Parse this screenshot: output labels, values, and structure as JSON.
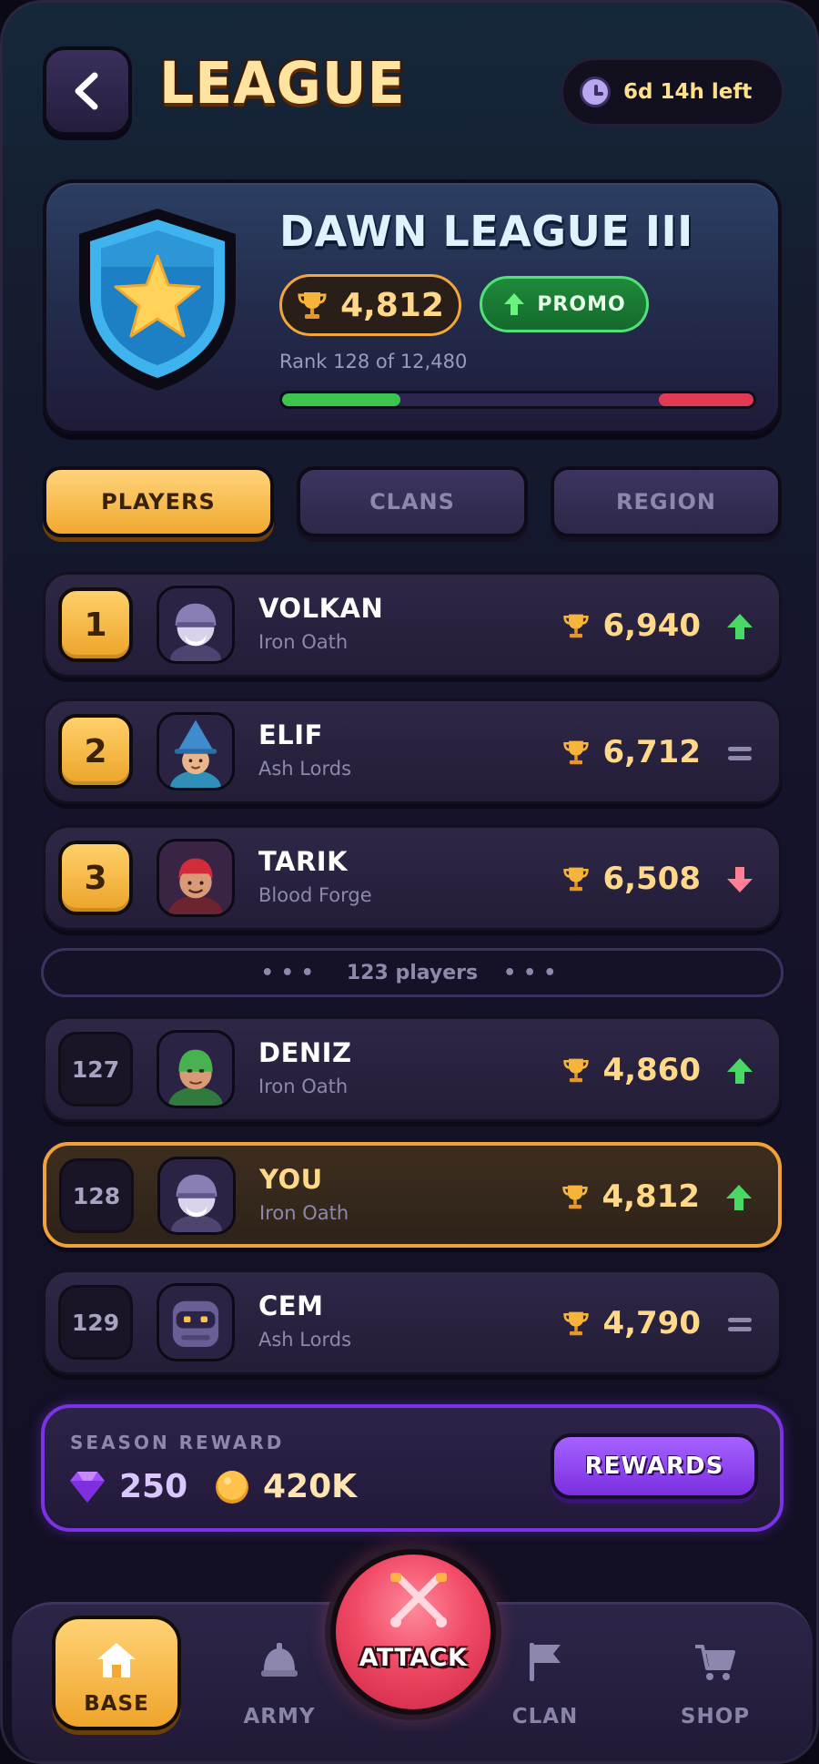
{
  "header": {
    "title": "LEAGUE",
    "timer_text": "6d 14h left"
  },
  "league": {
    "name": "DAWN LEAGUE III",
    "trophies": "4,812",
    "status_label": "PROMO",
    "rank_text": "Rank 128 of 12,480",
    "promo_zone_fraction": 0.25,
    "demotion_zone_fraction": 0.2
  },
  "tabs": [
    {
      "label": "PLAYERS",
      "active": true
    },
    {
      "label": "CLANS",
      "active": false
    },
    {
      "label": "REGION",
      "active": false
    }
  ],
  "top_players": [
    {
      "rank": "1",
      "name": "VOLKAN",
      "clan": "Iron Oath",
      "score": "6,940",
      "trend": "up",
      "avatar": "knight-avatar"
    },
    {
      "rank": "2",
      "name": "ELIF",
      "clan": "Ash Lords",
      "score": "6,712",
      "trend": "same",
      "avatar": "wizard-avatar"
    },
    {
      "rank": "3",
      "name": "TARIK",
      "clan": "Blood Forge",
      "score": "6,508",
      "trend": "down",
      "avatar": "warrior-avatar"
    }
  ],
  "gap_label": "123 players",
  "nearby_players": [
    {
      "rank": "127",
      "name": "DENIZ",
      "clan": "Iron Oath",
      "score": "4,860",
      "trend": "up",
      "avatar": "goblin-avatar",
      "is_me": false
    },
    {
      "rank": "128",
      "name": "YOU",
      "clan": "Iron Oath",
      "score": "4,812",
      "trend": "up",
      "avatar": "knight-avatar",
      "is_me": true
    },
    {
      "rank": "129",
      "name": "CEM",
      "clan": "Ash Lords",
      "score": "4,790",
      "trend": "same",
      "avatar": "robot-avatar",
      "is_me": false
    }
  ],
  "season_reward": {
    "label": "SEASON REWARD",
    "gems": "250",
    "gold": "420K",
    "button_label": "REWARDS"
  },
  "nav": {
    "base": "BASE",
    "army": "ARMY",
    "attack": "ATTACK",
    "clan": "CLAN",
    "shop": "SHOP"
  },
  "colors": {
    "accent_gold": "#f1a92f",
    "promo_green": "#3dc44f",
    "demote_red": "#e23a55",
    "reward_purple": "#7b33e6",
    "attack_red": "#f14a66"
  }
}
